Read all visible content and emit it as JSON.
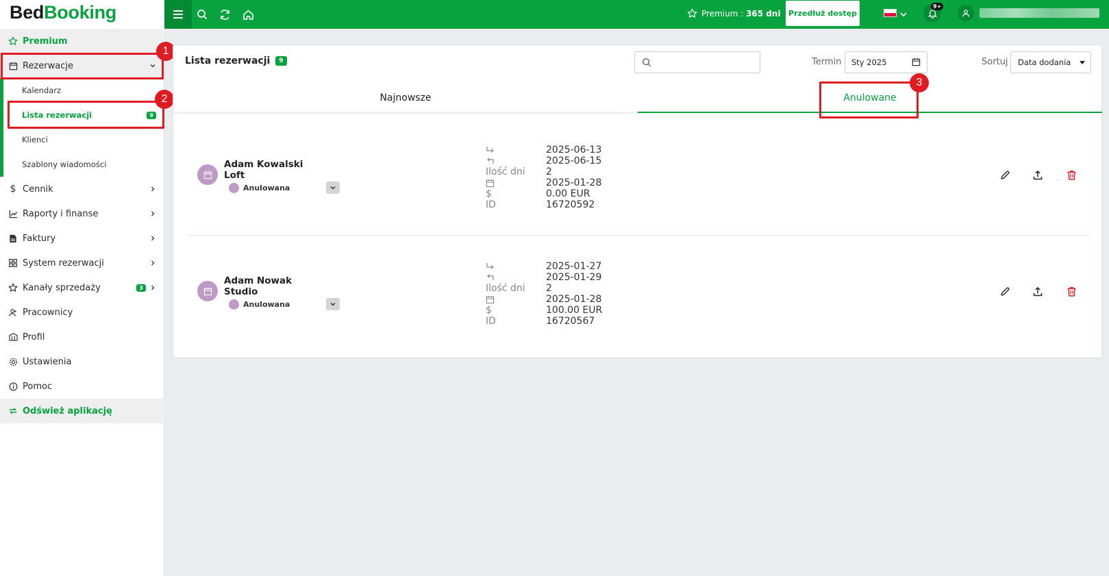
{
  "brand": {
    "part1": "Bed",
    "part2": "Booking",
    "green": "#07a33e"
  },
  "topbar": {
    "premium_label": "Premium : ",
    "premium_days": "365 dni",
    "extend_button": "Przedłuż dostęp",
    "notifications_badge": "9+",
    "icons": [
      "menu-icon",
      "search-icon",
      "refresh-icon",
      "home-icon",
      "star-icon",
      "bell-icon",
      "user-icon"
    ]
  },
  "sidebar": {
    "premium": "Premium",
    "reservations": "Rezerwacje",
    "sub": {
      "calendar": "Kalendarz",
      "list": "Lista rezerwacji",
      "list_badge": "9",
      "clients": "Klienci",
      "templates": "Szablony wiadomości"
    },
    "items": [
      {
        "label": "Cennik",
        "icon": "dollar-icon"
      },
      {
        "label": "Raporty i finanse",
        "icon": "chart-icon"
      },
      {
        "label": "Faktury",
        "icon": "invoice-icon"
      },
      {
        "label": "System rezerwacji",
        "icon": "grid-icon"
      },
      {
        "label": "Kanały sprzedaży",
        "icon": "star-icon",
        "badge": "3"
      },
      {
        "label": "Pracownicy",
        "icon": "users-icon"
      },
      {
        "label": "Profil",
        "icon": "building-icon"
      },
      {
        "label": "Ustawienia",
        "icon": "gear-icon"
      },
      {
        "label": "Pomoc",
        "icon": "info-icon"
      }
    ],
    "refresh": "Odśwież aplikację"
  },
  "annotations": {
    "one": "1",
    "two": "2",
    "three": "3"
  },
  "main": {
    "title": "Lista rezerwacji",
    "title_badge": "9",
    "search_placeholder": "",
    "termin_label": "Termin",
    "termin_value": "Sty 2025",
    "sort_label": "Sortuj",
    "sort_value": "Data dodania",
    "tabs": [
      {
        "label": "Najnowsze",
        "active": false
      },
      {
        "label": "Anulowane",
        "active": true
      }
    ],
    "field_labels": {
      "days": "Ilość dni",
      "id": "ID",
      "price_symbol": "$"
    },
    "reservations": [
      {
        "guest": "Adam Kowalski",
        "room": "Loft",
        "status": "Anulowana",
        "checkin": "2025-06-13",
        "checkout": "2025-06-15",
        "days": "2",
        "created": "2025-01-28",
        "price": "0.00 EUR",
        "id": "16720592"
      },
      {
        "guest": "Adam Nowak",
        "room": "Studio",
        "status": "Anulowana",
        "checkin": "2025-01-27",
        "checkout": "2025-01-29",
        "days": "2",
        "created": "2025-01-28",
        "price": "100.00 EUR",
        "id": "16720567"
      }
    ]
  }
}
